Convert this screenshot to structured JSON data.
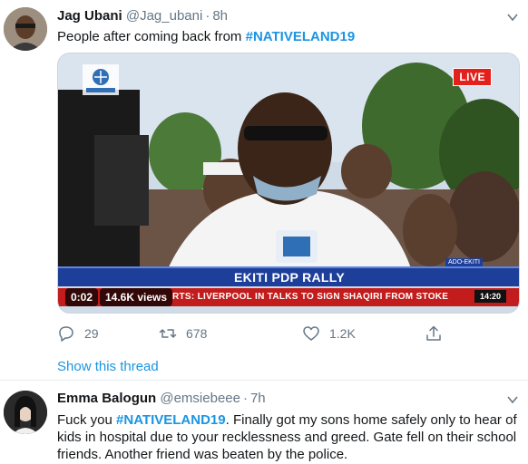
{
  "tweet1": {
    "name": "Jag Ubani",
    "handle": "@Jag_ubani",
    "separator": "·",
    "time": "8h",
    "text_prefix": "People after coming back from ",
    "hashtag": "#NATIVELAND19",
    "video": {
      "live_badge": "LIVE",
      "lower_third": "EKITI PDP RALLY",
      "location_tag": "ADO-EKITI",
      "ticker_text": "RTS: LIVERPOOL IN TALKS TO SIGN SHAQIRI FROM STOKE",
      "ticker_clock": "14:20",
      "elapsed": "0:02",
      "views": "14.6K views"
    },
    "actions": {
      "replies": "29",
      "retweets": "678",
      "likes": "1.2K"
    },
    "show_thread": "Show this thread"
  },
  "tweet2": {
    "name": "Emma Balogun",
    "handle": "@emsiebeee",
    "separator": "·",
    "time": "7h",
    "text_prefix": "Fuck you ",
    "hashtag": "#NATIVELAND19",
    "text_suffix": ". Finally got my sons home safely only to hear of kids in hospital due to your recklessness and greed. Gate fell on their school friends. Another friend was beaten by the police."
  },
  "colors": {
    "link": "#1b95e0",
    "muted": "#657786",
    "lower_third": "#1d3f9a",
    "ticker": "#c21c1c",
    "live": "#e3201b"
  },
  "icons": [
    "reply-icon",
    "retweet-icon",
    "like-icon",
    "share-icon",
    "caret-down-icon"
  ]
}
